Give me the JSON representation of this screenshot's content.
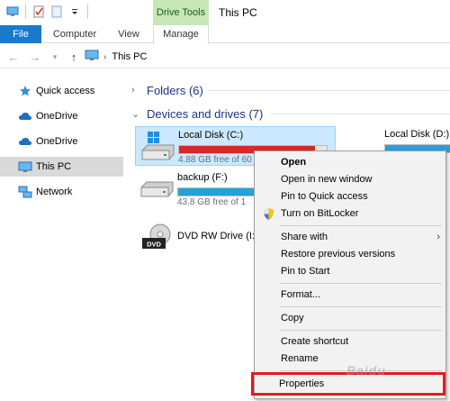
{
  "window": {
    "title": "This PC",
    "context_tab_group": "Drive Tools"
  },
  "ribbon": {
    "tabs": [
      {
        "label": "File"
      },
      {
        "label": "Computer"
      },
      {
        "label": "View"
      },
      {
        "label": "Manage"
      }
    ]
  },
  "address": {
    "crumb": "This PC"
  },
  "sidebar": {
    "items": [
      {
        "label": "Quick access",
        "icon": "star-icon"
      },
      {
        "label": "OneDrive",
        "icon": "cloud-icon"
      },
      {
        "label": "OneDrive",
        "icon": "cloud-icon"
      },
      {
        "label": "This PC",
        "icon": "computer-icon",
        "selected": true
      },
      {
        "label": "Network",
        "icon": "network-icon"
      }
    ]
  },
  "content": {
    "folders_group": {
      "label": "Folders (6)"
    },
    "drives_group": {
      "label": "Devices and drives (7)"
    },
    "drives": [
      {
        "name": "Local Disk (C:)",
        "free_text": "4.88 GB free of 60",
        "used_fraction": 0.92,
        "bar_color": "#da2626",
        "selected": true
      },
      {
        "name": "backup (F:)",
        "free_text": "43.8 GB free of 1",
        "used_fraction": 0.6,
        "bar_color": "#26a0da"
      },
      {
        "name": "DVD RW Drive (I:",
        "free_text": ""
      },
      {
        "name": "Local Disk (D:)",
        "free_text": "",
        "used_fraction": 0.5,
        "bar_color": "#26a0da"
      }
    ]
  },
  "context_menu": {
    "items": [
      {
        "label": "Open",
        "bold": true
      },
      {
        "label": "Open in new window"
      },
      {
        "label": "Pin to Quick access"
      },
      {
        "label": "Turn on BitLocker",
        "icon": "shield-icon"
      },
      {
        "label": "Share with",
        "submenu": true
      },
      {
        "label": "Restore previous versions"
      },
      {
        "label": "Pin to Start"
      },
      {
        "label": "Format..."
      },
      {
        "label": "Copy"
      },
      {
        "label": "Create shortcut"
      },
      {
        "label": "Rename"
      },
      {
        "label": "Properties",
        "highlighted": true
      }
    ],
    "submenu_arrow": "›"
  },
  "watermark": {
    "text": "Baidu"
  },
  "colors": {
    "accent": "#1979ca",
    "context_green": "#c7e8b6",
    "selection": "#cce8ff",
    "highlight_box": "#e01b24"
  }
}
